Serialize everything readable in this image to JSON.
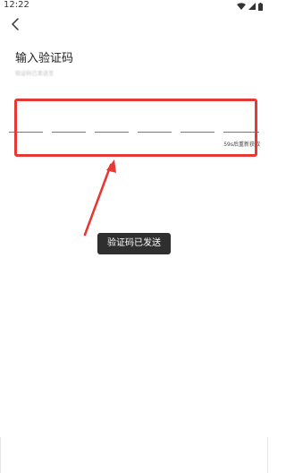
{
  "status_bar": {
    "time": "12:22"
  },
  "header": {
    "title": "输入验证码",
    "subtitle": "验证码已发送至"
  },
  "code_input": {
    "slot_count": 6
  },
  "resend": {
    "label": "59s后重新获取"
  },
  "toast": {
    "message": "验证码已发送"
  },
  "colors": {
    "annotation": "#e53935",
    "toast_background": "#2f2f2f",
    "slot_line": "#777777"
  },
  "icons": {
    "back": "chevron-left-icon",
    "wifi": "wifi-icon",
    "signal": "signal-icon",
    "battery": "battery-icon"
  }
}
